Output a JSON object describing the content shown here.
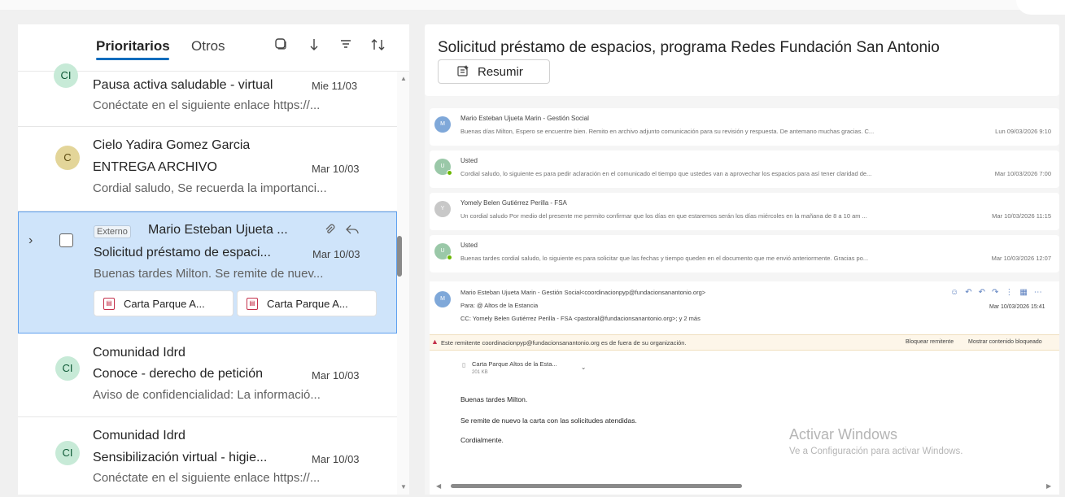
{
  "list": {
    "tabs": {
      "focused": "Prioritarios",
      "other": "Otros"
    },
    "header_icons": [
      "select-mode-icon",
      "jump-to-icon",
      "filter-icon",
      "sort-icon"
    ],
    "items": [
      {
        "avatar": "CI",
        "sender": "",
        "subject": "Pausa activa saludable - virtual",
        "date": "Mie 11/03",
        "preview": "Conéctate en el siguiente enlace https://..."
      },
      {
        "avatar": "C",
        "sender": "Cielo Yadira Gomez Garcia",
        "subject": "ENTREGA ARCHIVO",
        "date": "Mar 10/03",
        "preview": "Cordial saludo, Se recuerda la importanci..."
      },
      {
        "badge": "Externo",
        "sender": "Mario Esteban Ujueta ...",
        "subject": "Solicitud préstamo de espaci...",
        "date": "Mar 10/03",
        "preview": "Buenas tardes Milton. Se remite de nuev...",
        "attachments": [
          "Carta Parque A...",
          "Carta Parque A..."
        ]
      },
      {
        "avatar": "CI",
        "sender": "Comunidad Idrd",
        "subject": "Conoce - derecho de petición",
        "date": "Mar 10/03",
        "preview": "Aviso de confidencialidad: La informació..."
      },
      {
        "avatar": "CI",
        "sender": "Comunidad Idrd",
        "subject": "Sensibilización virtual - higie...",
        "date": "Mar 10/03",
        "preview": "Conéctate en el siguiente enlace https://..."
      }
    ]
  },
  "reading": {
    "subject": "Solicitud préstamo de espacios, programa Redes Fundación San Antonio",
    "summarize_label": "Resumir",
    "thread": [
      {
        "initial": "M",
        "name": "Mario Esteban Ujueta Marin - Gestión Social",
        "preview": "Buenas días Milton, Espero se encuentre bien. Remito en archivo adjunto comunicación para su revisión y respuesta. De antemano muchas gracias. C...",
        "date": "Lun 09/03/2026 9:10"
      },
      {
        "initial": "U",
        "name": "Usted",
        "preview": "Cordial saludo, lo siguiente es para pedir aclaración en el comunicado el tiempo que ustedes van a aprovechar los espacios para así tener claridad de...",
        "date": "Mar 10/03/2026 7:00"
      },
      {
        "initial": "Y",
        "name": "Yomely Belen Gutiérrez Perilla - FSA",
        "preview": "Un cordial saludo Por medio del presente me permito confirmar que los días en que estaremos serán los días miércoles en la mañana de 8 a 10 am ...",
        "date": "Mar 10/03/2026 11:15"
      },
      {
        "initial": "U",
        "name": "Usted",
        "preview": "Buenas tardes cordial saludo, lo siguiente es para solicitar que las fechas y tiempo queden en el documento que me envió anteriormente. Gracias po...",
        "date": "Mar 10/03/2026 12:07"
      }
    ],
    "open_message": {
      "initial": "M",
      "from": "Mario Esteban Ujueta Marin - Gestión Social<coordinacionpyp@fundacionsanantonio.org>",
      "to": "Para: @ Altos de la Estancia",
      "cc": "CC: Yomely Belen Gutiérrez Perilla - FSA <pastoral@fundacionsanantonio.org>; y 2 más",
      "date": "Mar 10/03/2026 15:41",
      "warning": "Este remitente coordinacionpyp@fundacionsanantonio.org es de fuera de su organización.",
      "warning_actions": [
        "Bloquear remitente",
        "Mostrar contenido bloqueado"
      ],
      "attachment": "Carta Parque Altos de la Esta...",
      "attachment_size": "201 KB",
      "body": [
        "Buenas tardes Milton.",
        "Se remite de nuevo la carta  con las solicitudes atendidas.",
        "Cordialmente."
      ]
    },
    "watermark": {
      "title": "Activar Windows",
      "subtitle": "Ve a Configuración para activar Windows."
    }
  }
}
